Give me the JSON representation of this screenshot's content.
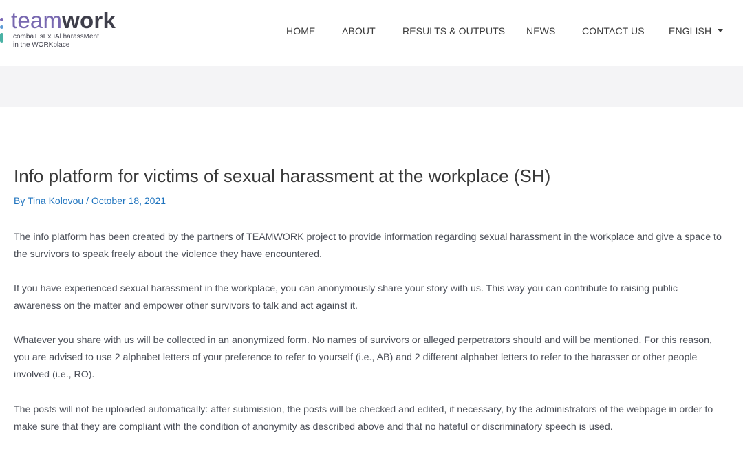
{
  "logo": {
    "word_light": "team",
    "word_bold": "work",
    "tagline_1": "combaT sExuAl harassMent",
    "tagline_2": "in the WORKplace"
  },
  "nav": {
    "items": [
      "HOME",
      "ABOUT",
      "RESULTS & OUTPUTS",
      "NEWS",
      "CONTACT US"
    ],
    "language": "ENGLISH"
  },
  "post": {
    "title": "Info platform for victims of sexual harassment at the workplace (SH)",
    "by": "By",
    "author": "Tina Kolovou",
    "separator": "/",
    "date": "October 18, 2021",
    "paragraphs": [
      "The info platform has been created by the partners of TEAMWORK project to provide information regarding sexual harassment in the workplace and give a space to the survivors to speak freely about the violence they have encountered.",
      "If you have experienced sexual harassment in the workplace, you can anonymously share your story with us. This way you can contribute to raising public awareness on the matter and empower other survivors to talk and act against it.",
      "Whatever you share with us will be collected in an anonymized form. No names of survivors or alleged perpetrators should and will be mentioned. For this reason, you are advised to use 2 alphabet letters of your preference to refer to yourself (i.e., AB) and 2 different alphabet letters to refer to the harasser or other people involved (i.e., RO).",
      "The posts will not be uploaded automatically: after submission, the posts will be checked and edited, if necessary, by the administrators of the webpage in order to make sure that they are compliant with the condition of anonymity as described above and that no hateful or discriminatory speech is used."
    ]
  },
  "colors": {
    "link": "#1e73be",
    "logo_purple": "#7868b0",
    "band": "#f4f4f6"
  }
}
